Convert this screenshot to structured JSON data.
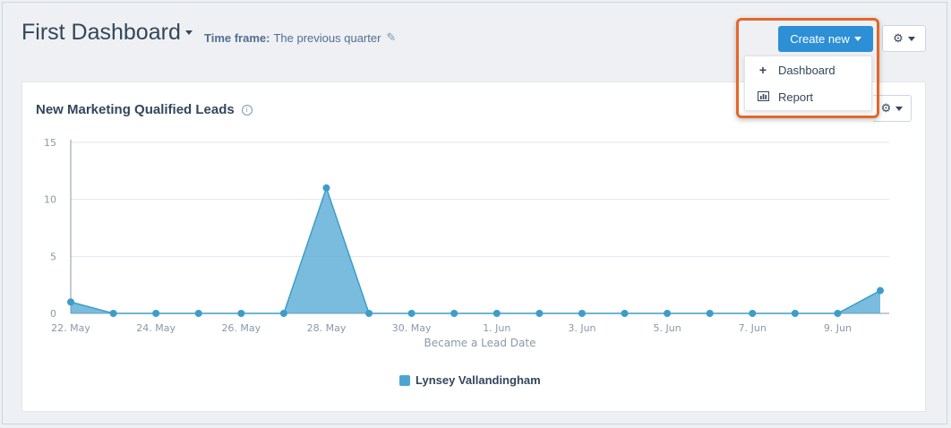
{
  "dashboard": {
    "title": "First Dashboard",
    "timeframe_label": "Time frame:",
    "timeframe_value": "The previous quarter"
  },
  "toolbar": {
    "create_label": "Create new"
  },
  "create_menu": {
    "items": [
      {
        "label": "Dashboard",
        "icon": "plus-icon"
      },
      {
        "label": "Report",
        "icon": "bar-chart-icon"
      }
    ]
  },
  "report": {
    "title": "New Marketing Qualified Leads"
  },
  "colors": {
    "accent": "#2d8fd5",
    "series": "#4da6d1",
    "highlight": "#e5662a"
  },
  "chart_data": {
    "type": "area",
    "xlabel": "Became a Lead Date",
    "ylabel": "",
    "ylim": [
      0,
      15
    ],
    "yticks": [
      "0",
      "5",
      "10",
      "15"
    ],
    "x": [
      "22. May",
      "23. May",
      "24. May",
      "25. May",
      "26. May",
      "27. May",
      "28. May",
      "29. May",
      "30. May",
      "31. May",
      "1. Jun",
      "2. Jun",
      "3. Jun",
      "4. Jun",
      "5. Jun",
      "6. Jun",
      "7. Jun",
      "8. Jun",
      "9. Jun",
      "10. Jun"
    ],
    "xtick_labels": [
      "22. May",
      "24. May",
      "26. May",
      "28. May",
      "30. May",
      "1. Jun",
      "3. Jun",
      "5. Jun",
      "7. Jun",
      "9. Jun"
    ],
    "series": [
      {
        "name": "Lynsey Vallandingham",
        "values": [
          1,
          0,
          0,
          0,
          0,
          0,
          11,
          0,
          0,
          0,
          0,
          0,
          0,
          0,
          0,
          0,
          0,
          0,
          0,
          2
        ]
      }
    ],
    "grid": true,
    "legend": "bottom"
  }
}
